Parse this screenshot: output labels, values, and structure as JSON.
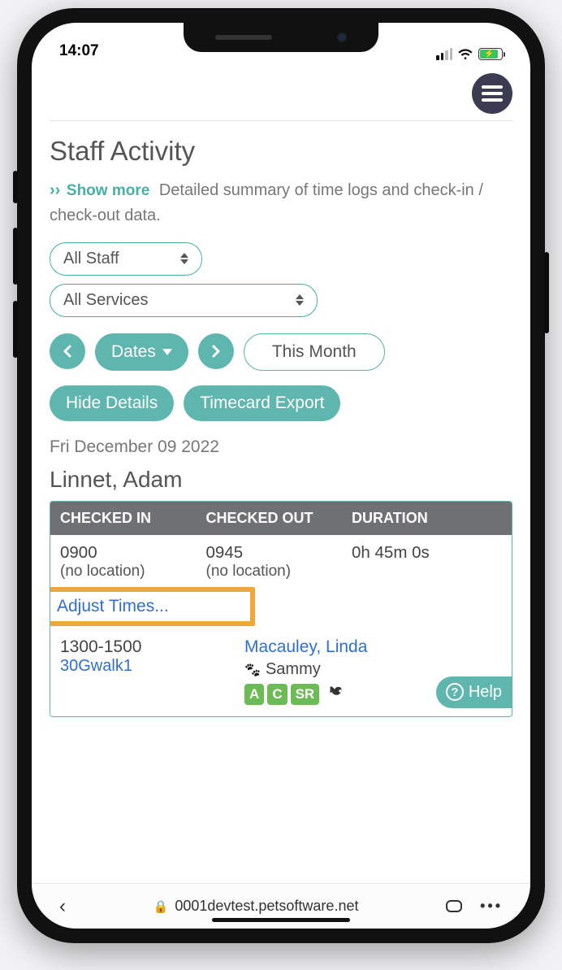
{
  "status": {
    "time": "14:07"
  },
  "page": {
    "title": "Staff Activity",
    "show_more": "Show more",
    "description": "Detailed summary of time logs and check-in / check-out data."
  },
  "filters": {
    "staff": "All Staff",
    "service": "All Services"
  },
  "date_nav": {
    "dates_btn": "Dates",
    "range_label": "This Month"
  },
  "actions": {
    "hide_details": "Hide Details",
    "timecard_export": "Timecard Export"
  },
  "date_label": "Fri December 09 2022",
  "staff_name": "Linnet, Adam",
  "table": {
    "headers": {
      "col1": "CHECKED IN",
      "col2": "CHECKED OUT",
      "col3": "DURATION"
    },
    "row1": {
      "in_time": "0900",
      "in_loc": "(no location)",
      "out_time": "0945",
      "out_loc": "(no location)",
      "duration": "0h 45m 0s"
    },
    "adjust": "Adjust Times...",
    "row2": {
      "time_range": "1300-1500",
      "service_code": "30Gwalk1",
      "client": "Macauley, Linda",
      "pet": "Sammy",
      "badge_a": "A",
      "badge_c": "C",
      "badge_sr": "SR"
    }
  },
  "help": "Help",
  "browser": {
    "url": "0001devtest.petsoftware.net"
  }
}
